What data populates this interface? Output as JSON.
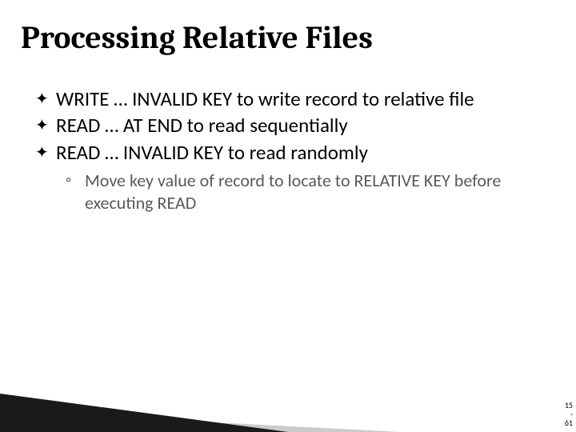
{
  "title": "Processing Relative Files",
  "bullets": [
    {
      "text": "WRITE … INVALID KEY to write record to relative file"
    },
    {
      "text": "READ … AT END to read sequentially"
    },
    {
      "text": "READ … INVALID KEY to read randomly",
      "sub": [
        {
          "text": "Move key value of record to locate to RELATIVE KEY before executing READ"
        }
      ]
    }
  ],
  "page": {
    "chapter": "15",
    "sep": "-",
    "num": "61"
  }
}
